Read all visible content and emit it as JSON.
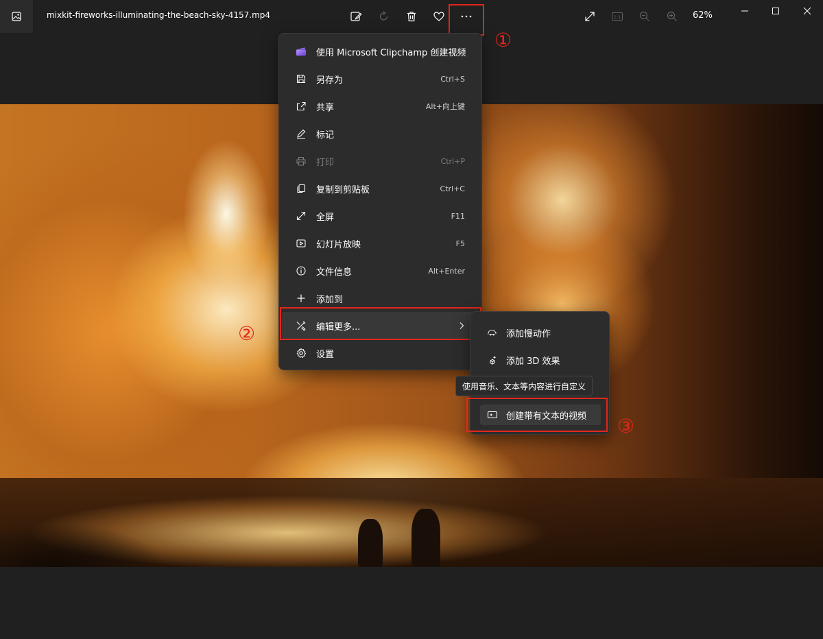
{
  "titlebar": {
    "file_name": "mixkit-fireworks-illuminating-the-beach-sky-4157.mp4",
    "zoom": "62%",
    "icons": [
      "photos-app-icon",
      "edit-image-icon",
      "rotate-icon",
      "delete-icon",
      "favorite-heart-icon",
      "more-options-icon",
      "fullscreen-expand-icon",
      "actual-size-icon",
      "zoom-out-icon",
      "zoom-in-icon",
      "minimize-icon",
      "maximize-icon",
      "close-icon"
    ],
    "zoom_actual_size_label": "1:1"
  },
  "menu": {
    "items": [
      {
        "label": "使用 Microsoft Clipchamp 创建视频",
        "shortcut": "",
        "icon": "clipchamp-icon",
        "disabled": false
      },
      {
        "label": "另存为",
        "shortcut": "Ctrl+S",
        "icon": "save-icon",
        "disabled": false
      },
      {
        "label": "共享",
        "shortcut": "Alt+向上键",
        "icon": "share-icon",
        "disabled": false
      },
      {
        "label": "标记",
        "shortcut": "",
        "icon": "pen-icon",
        "disabled": false
      },
      {
        "label": "打印",
        "shortcut": "Ctrl+P",
        "icon": "print-icon",
        "disabled": true
      },
      {
        "label": "复制到剪贴板",
        "shortcut": "Ctrl+C",
        "icon": "copy-icon",
        "disabled": false
      },
      {
        "label": "全屏",
        "shortcut": "F11",
        "icon": "fullscreen-icon",
        "disabled": false
      },
      {
        "label": "幻灯片放映",
        "shortcut": "F5",
        "icon": "slideshow-icon",
        "disabled": false
      },
      {
        "label": "文件信息",
        "shortcut": "Alt+Enter",
        "icon": "info-icon",
        "disabled": false
      },
      {
        "label": "添加到",
        "shortcut": "",
        "icon": "plus-icon",
        "disabled": false
      },
      {
        "label": "编辑更多...",
        "shortcut": "",
        "icon": "edit-tools-icon",
        "disabled": false,
        "has_submenu": true
      },
      {
        "label": "设置",
        "shortcut": "",
        "icon": "settings-gear-icon",
        "disabled": false
      }
    ]
  },
  "submenu": {
    "items": [
      {
        "label": "添加慢动作",
        "icon": "slow-motion-icon"
      },
      {
        "label": "添加 3D 效果",
        "icon": "3d-effects-icon"
      },
      {
        "label": "创建带有文本的视频",
        "icon": "video-text-icon",
        "selected": true
      }
    ],
    "tooltip": "使用音乐、文本等内容进行自定义"
  },
  "annotations": {
    "marker_1": "①",
    "marker_2": "②",
    "marker_3": "③",
    "color": "#e3261c"
  }
}
